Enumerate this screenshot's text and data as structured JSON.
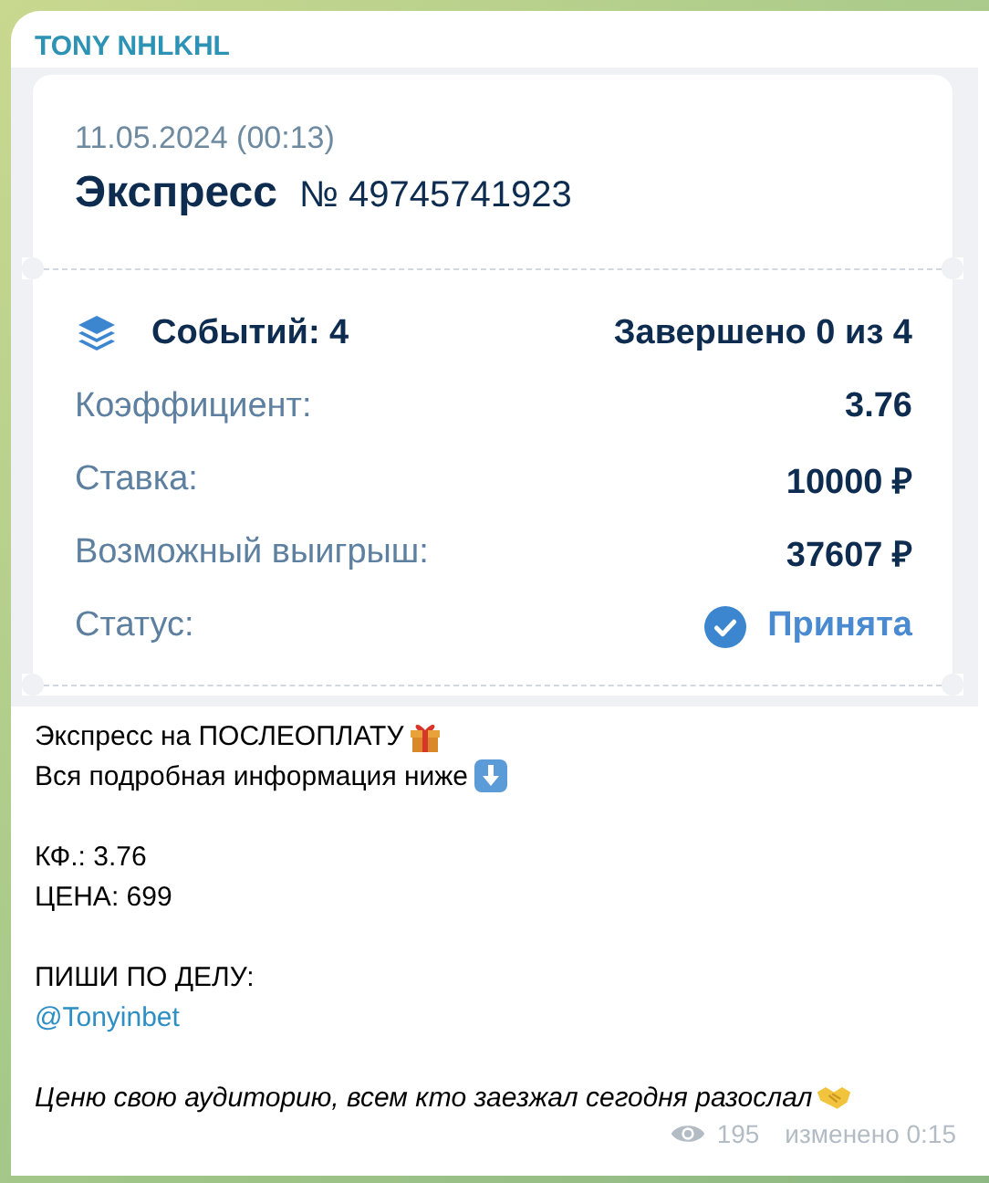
{
  "channel": {
    "name": "TONY NHLKHL"
  },
  "ticket": {
    "date": "11.05.2024 (00:13)",
    "type": "Экспресс",
    "number": "№ 49745741923",
    "events": "Событий: 4",
    "completed": "Завершено 0 из 4",
    "rows": [
      {
        "label": "Коэффициент:",
        "value": "3.76",
        "kind": "plain"
      },
      {
        "label": "Ставка:",
        "value": "10000 ₽",
        "kind": "plain"
      },
      {
        "label": "Возможный выигрыш:",
        "value": "37607 ₽",
        "kind": "plain"
      },
      {
        "label": "Статус:",
        "value": "Принята",
        "kind": "status"
      }
    ]
  },
  "message": {
    "paragraphs": [
      [
        {
          "text": "Экспресс на ПОСЛЕОПЛАТУ",
          "kind": "plain"
        },
        {
          "text": "Вся подробная информация ниже",
          "kind": "plain"
        }
      ],
      [
        {
          "text": "КФ.: 3.76",
          "kind": "plain"
        },
        {
          "text": "ЦЕНА: 699",
          "kind": "plain"
        }
      ],
      [
        {
          "text": "ПИШИ ПО ДЕЛУ:",
          "kind": "plain"
        },
        {
          "text": "@Tonyinbet",
          "kind": "link"
        }
      ],
      [
        {
          "text": "Ценю свою аудиторию, всем кто заезжал сегодня разослал",
          "kind": "italic"
        }
      ]
    ]
  },
  "footer": {
    "views": "195",
    "edited": "изменено 0:15"
  }
}
